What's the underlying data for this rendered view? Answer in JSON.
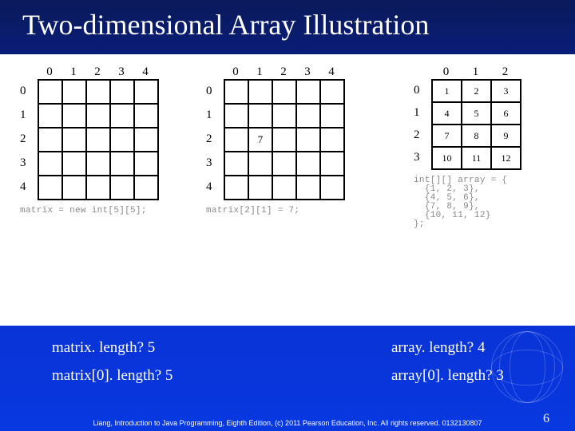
{
  "title": "Two-dimensional Array Illustration",
  "grid1": {
    "cols": [
      "0",
      "1",
      "2",
      "3",
      "4"
    ],
    "rows": [
      "0",
      "1",
      "2",
      "3",
      "4"
    ],
    "caption": "matrix = new int[5][5];"
  },
  "grid2": {
    "cols": [
      "0",
      "1",
      "2",
      "3",
      "4"
    ],
    "rows": [
      "0",
      "1",
      "2",
      "3",
      "4"
    ],
    "cell_2_1": "7",
    "caption": "matrix[2][1] = 7;"
  },
  "grid3": {
    "cols": [
      "0",
      "1",
      "2"
    ],
    "rows": [
      "0",
      "1",
      "2",
      "3"
    ],
    "cells": [
      [
        "1",
        "2",
        "3"
      ],
      [
        "4",
        "5",
        "6"
      ],
      [
        "7",
        "8",
        "9"
      ],
      [
        "10",
        "11",
        "12"
      ]
    ],
    "caption": "int[][] array = {\n  {1, 2, 3},\n  {4, 5, 6},\n  {7, 8, 9},\n  {10, 11, 12}\n};"
  },
  "bottom": {
    "matrix_length": "matrix. length?  5",
    "matrix0_length": "matrix[0]. length? 5",
    "array_length": "array. length?  4",
    "array0_length": "array[0]. length? 3"
  },
  "footer": "Liang, Introduction to Java Programming, Eighth Edition, (c) 2011 Pearson Education, Inc. All rights reserved. 0132130807",
  "page": "6",
  "chart_data": [
    {
      "type": "table",
      "title": "matrix = new int[5][5];",
      "categories": [
        "0",
        "1",
        "2",
        "3",
        "4"
      ],
      "rows": [
        "0",
        "1",
        "2",
        "3",
        "4"
      ],
      "values": [
        [
          null,
          null,
          null,
          null,
          null
        ],
        [
          null,
          null,
          null,
          null,
          null
        ],
        [
          null,
          null,
          null,
          null,
          null
        ],
        [
          null,
          null,
          null,
          null,
          null
        ],
        [
          null,
          null,
          null,
          null,
          null
        ]
      ]
    },
    {
      "type": "table",
      "title": "matrix[2][1] = 7;",
      "categories": [
        "0",
        "1",
        "2",
        "3",
        "4"
      ],
      "rows": [
        "0",
        "1",
        "2",
        "3",
        "4"
      ],
      "values": [
        [
          null,
          null,
          null,
          null,
          null
        ],
        [
          null,
          null,
          null,
          null,
          null
        ],
        [
          null,
          7,
          null,
          null,
          null
        ],
        [
          null,
          null,
          null,
          null,
          null
        ],
        [
          null,
          null,
          null,
          null,
          null
        ]
      ]
    },
    {
      "type": "table",
      "title": "int[][] array literal",
      "categories": [
        "0",
        "1",
        "2"
      ],
      "rows": [
        "0",
        "1",
        "2",
        "3"
      ],
      "values": [
        [
          1,
          2,
          3
        ],
        [
          4,
          5,
          6
        ],
        [
          7,
          8,
          9
        ],
        [
          10,
          11,
          12
        ]
      ]
    }
  ]
}
